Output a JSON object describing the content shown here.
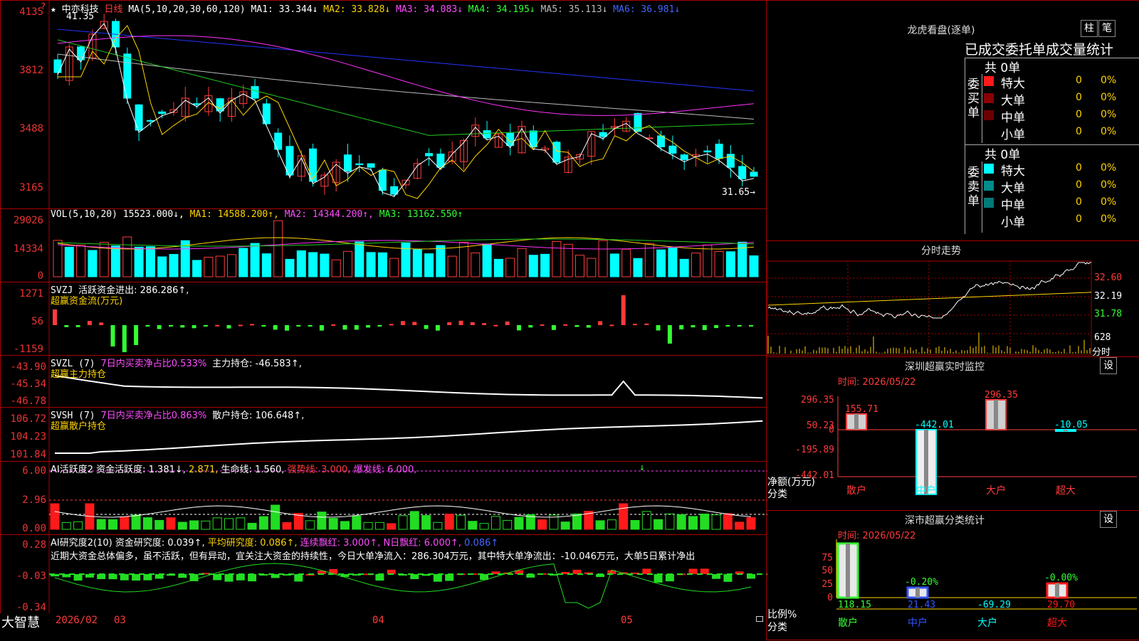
{
  "main_chart": {
    "star": "★",
    "stock_name": "中亦科技",
    "period": "日线",
    "ma_params": "MA(5,10,20,30,60,120)",
    "ma1": "MA1: 33.344↓",
    "ma2": "MA2: 33.828↓",
    "ma3": "MA3: 34.083↓",
    "ma4": "MA4: 34.195↓",
    "ma5": "MA5: 35.113↓",
    "ma6": "MA6: 36.981↓",
    "y_labels": [
      "4135",
      "3812",
      "3488",
      "3165"
    ],
    "high_mark": "41.35",
    "low_mark": "31.65→",
    "corner": "?"
  },
  "vol_panel": {
    "title": "VOL(5,10,20)",
    "value": "15523.000↓,",
    "ma1": "MA1: 14588.200↑,",
    "ma2": "MA2: 14344.200↑,",
    "ma3": "MA3: 13162.550↑",
    "y_labels": [
      "29026",
      "14334",
      "0"
    ]
  },
  "svzj_panel": {
    "title": "SVZJ",
    "line1": "活跃资金进出: 286.286↑,",
    "line2": "超赢资金流(万元)",
    "y_labels": [
      "1271",
      "56",
      "-1159"
    ]
  },
  "svzl_panel": {
    "title": "SVZL (7)",
    "pct": "7日内买卖净占比0.533%",
    "holding": "主力持仓: -46.583↑,",
    "line2": "超赢主力持仓",
    "y_labels": [
      "-43.90",
      "-45.34",
      "-46.78"
    ]
  },
  "svsh_panel": {
    "title": "SVSH (7)",
    "pct": "7日内买卖净占比0.863%",
    "holding": "散户持仓: 106.648↑,",
    "line2": "超赢散户持仓",
    "y_labels": [
      "106.72",
      "104.23",
      "101.84"
    ]
  },
  "ai_active_panel": {
    "title": "AI活跃度2",
    "active": "资金活跃度: 1.381↓,",
    "v2": "2.871,",
    "life": "生命线: 1.560,",
    "strong": "强势线: 3.000,",
    "burst": "爆发线: 6.000,",
    "y_labels": [
      "6.00",
      "2.96",
      "0.00"
    ]
  },
  "ai_research_panel": {
    "title": "AI研究度2(10)",
    "research": "资金研究度: 0.039↑,",
    "avg": "平均研究度: 0.086↑,",
    "cont": "连续飘红: 3.000↑,",
    "nday": "N日飘红: 6.000↑,",
    "last": "0.086↑",
    "commentary": "近期大资金总体偏多，虽不活跃，但有异动，宜关注大资金的持续性，今日大单净流入：286.304万元，其中特大单净流出：-10.046万元，大单5日累计净出",
    "y_labels": [
      "0.28",
      "-0.03",
      "-0.34"
    ]
  },
  "bottom_axis": {
    "brand": "大智慧",
    "labels": [
      "2026/02",
      "03",
      "04",
      "05"
    ]
  },
  "dragon_tiger": {
    "title": "龙虎看盘(逐单)",
    "btn1": "柱",
    "btn2": "笔",
    "subtitle": "已成交委托单成交量统计",
    "buy_label": "委买单",
    "buy_total": "共 0单",
    "sell_label": "委卖单",
    "sell_total": "共 0单",
    "buy_rows": [
      {
        "name": "特大",
        "count": "0",
        "pct": "0%",
        "color": "#ff1a1a"
      },
      {
        "name": "大单",
        "count": "0",
        "pct": "0%",
        "color": "#8b0000"
      },
      {
        "name": "中单",
        "count": "0",
        "pct": "0%",
        "color": "#6a0000"
      },
      {
        "name": "小单",
        "count": "0",
        "pct": "0%",
        "color": ""
      }
    ],
    "sell_rows": [
      {
        "name": "特大",
        "count": "0",
        "pct": "0%",
        "color": "#00ffff"
      },
      {
        "name": "大单",
        "count": "0",
        "pct": "0%",
        "color": "#008b8b"
      },
      {
        "name": "中单",
        "count": "0",
        "pct": "0%",
        "color": "#007a7a"
      },
      {
        "name": "小单",
        "count": "0",
        "pct": "0%",
        "color": ""
      }
    ]
  },
  "intraday": {
    "title": "分时走势",
    "y_labels": [
      "32.60",
      "32.19",
      "31.78"
    ],
    "vol_labels": [
      "628",
      "分时"
    ]
  },
  "sz_monitor": {
    "title": "深圳超赢实时监控",
    "set": "设",
    "time": "时间: 2026/05/22",
    "y_labels": [
      "296.35",
      "50.23",
      "0",
      "-195.89",
      "-442.01"
    ],
    "bars": [
      {
        "cat": "散户",
        "value": 155.71,
        "label": "155.71"
      },
      {
        "cat": "中户",
        "value": -442.01,
        "label": "-442.01"
      },
      {
        "cat": "大户",
        "value": 296.35,
        "label": "296.35"
      },
      {
        "cat": "超大",
        "value": -10.05,
        "label": "-10.05"
      }
    ],
    "yaxis_title": "净额(万元)",
    "xaxis_title": "分类"
  },
  "sz_class": {
    "title": "深市超赢分类统计",
    "set": "设",
    "time": "时间: 2026/05/22",
    "y_labels": [
      "75",
      "50",
      "25",
      "0"
    ],
    "bars": [
      {
        "cat": "散户",
        "value": 118.15,
        "label": "118.15",
        "pct": ""
      },
      {
        "cat": "中户",
        "value": 21.43,
        "label": "21.43",
        "pct": "-0.20%"
      },
      {
        "cat": "大户",
        "value": -69.29,
        "label": "-69.29",
        "pct": ""
      },
      {
        "cat": "超大",
        "value": 29.7,
        "label": "29.70",
        "pct": "-0.00%"
      }
    ],
    "yaxis_title": "比例%",
    "xaxis_title": "分类"
  }
}
